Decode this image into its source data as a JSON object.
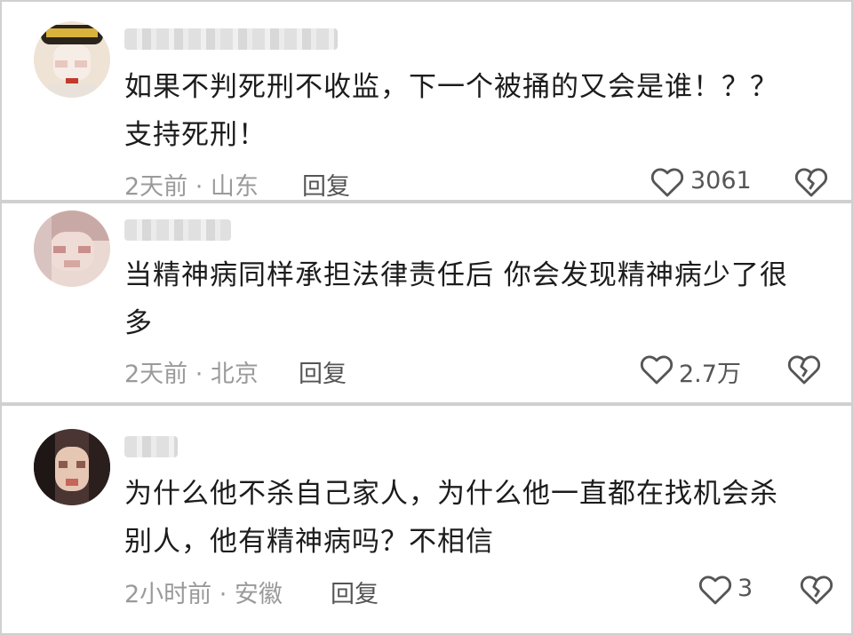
{
  "comments": [
    {
      "text_line1": "如果不判死刑不收监，下一个被捅的又会是谁！？？",
      "text_line2": "支持死刑！",
      "meta": "2天前 · 山东",
      "reply_label": "回复",
      "likes": "3061",
      "like_icon": "heart-outline-icon",
      "dislike_icon": "broken-heart-icon"
    },
    {
      "text_line1": "当精神病同样承担法律责任后 你会发现精神病少了很",
      "text_line2": "多",
      "meta": "2天前 · 北京",
      "reply_label": "回复",
      "likes": "2.7万",
      "like_icon": "heart-outline-icon",
      "dislike_icon": "broken-heart-icon"
    },
    {
      "text_line1": "为什么他不杀自己家人，为什么他一直都在找机会杀",
      "text_line2": "别人，他有精神病吗？不相信",
      "meta": "2小时前 · 安徽",
      "reply_label": "回复",
      "likes": "3",
      "like_icon": "heart-outline-icon",
      "dislike_icon": "broken-heart-icon"
    }
  ],
  "colors": {
    "background": "#d0d0d0",
    "card": "#ffffff",
    "text": "#1c1c1c",
    "meta": "#9a9a9a",
    "action": "#555555"
  }
}
